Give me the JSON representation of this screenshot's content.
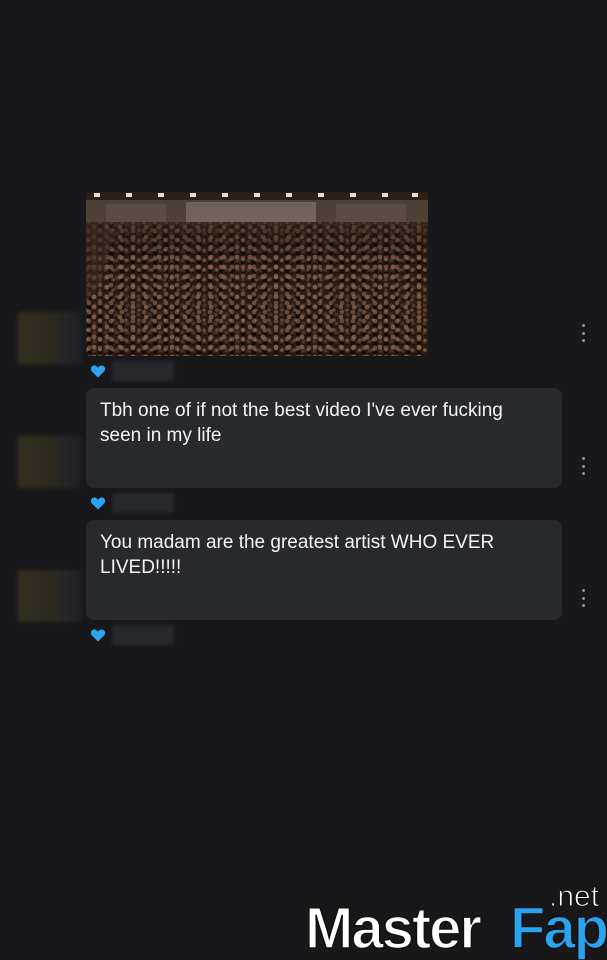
{
  "messages": [
    {
      "type": "media",
      "reaction_icon": "heart-icon"
    },
    {
      "type": "text",
      "text": "Tbh one of if not the best video I've ever fucking seen in my life",
      "reaction_icon": "heart-icon"
    },
    {
      "type": "text",
      "text": "You madam are the greatest artist WHO EVER LIVED!!!!!",
      "reaction_icon": "heart-icon"
    }
  ],
  "colors": {
    "background": "#18181b",
    "bubble": "#27292c",
    "reaction_heart": "#2aa3f0",
    "watermark_accent": "#2aa3f0"
  },
  "watermark": {
    "brand": "MasterFap",
    "tld": ".net"
  }
}
